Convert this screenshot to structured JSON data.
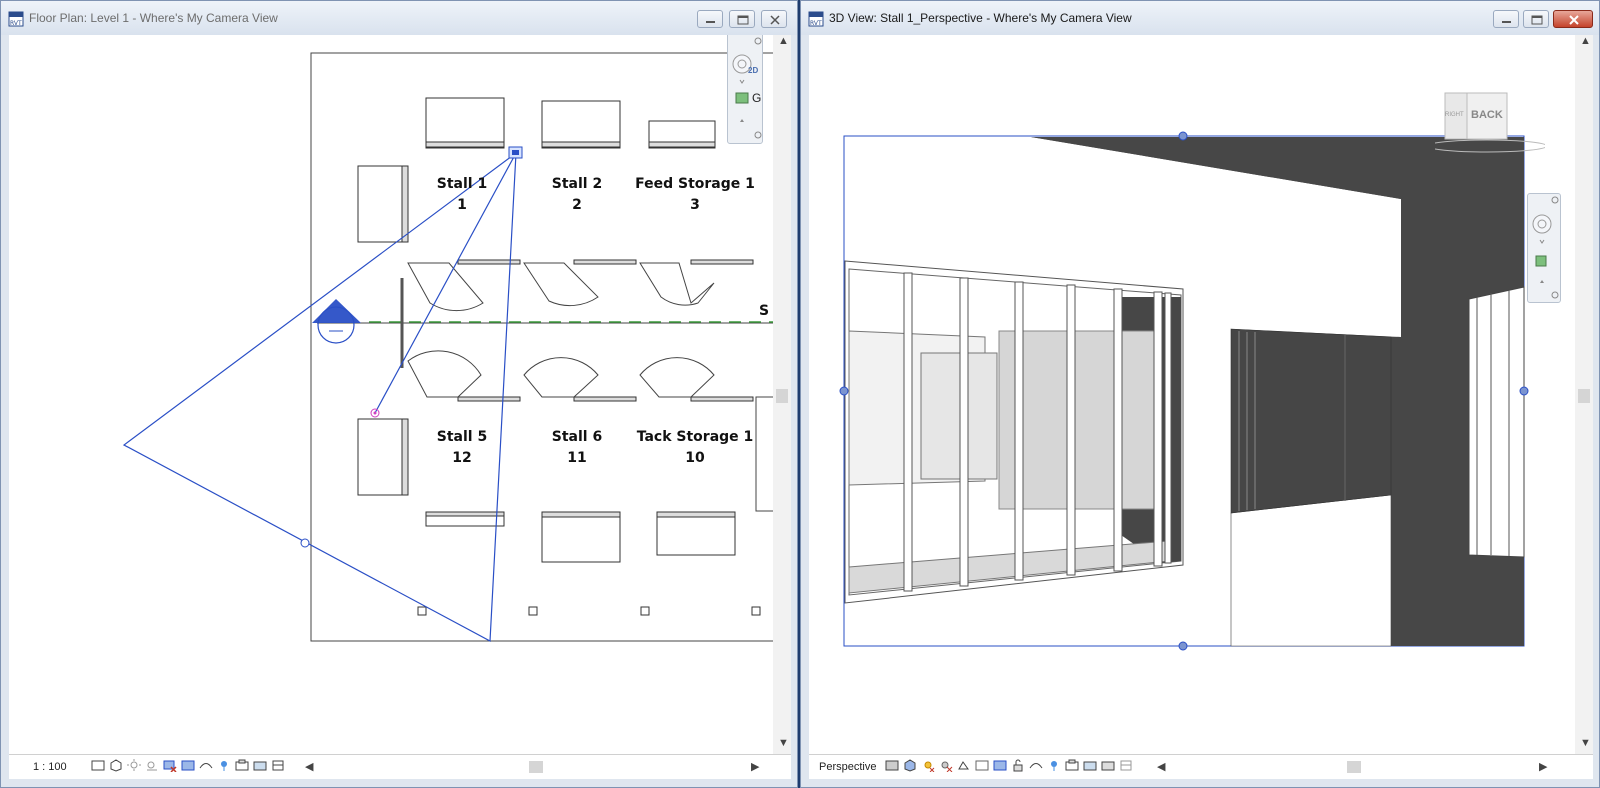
{
  "left_window": {
    "title": "Floor Plan: Level 1 - Where's My Camera View",
    "scale": "1 : 100",
    "rooms": [
      {
        "name": "Stall 1",
        "number": "1"
      },
      {
        "name": "Stall 2",
        "number": "2"
      },
      {
        "name": "Feed Storage 1",
        "number": "3"
      },
      {
        "name": "Stall 5",
        "number": "12"
      },
      {
        "name": "Stall 6",
        "number": "11"
      },
      {
        "name": "Tack Storage 1",
        "number": "10"
      }
    ],
    "partial_label": "S",
    "nav_tool_2d": "2D",
    "nav_tool_g": "G"
  },
  "right_window": {
    "title": "3D View: Stall 1_Perspective - Where's My Camera View",
    "view_mode": "Perspective",
    "viewcube": {
      "front": "BACK",
      "side": "RIGHT"
    }
  },
  "colors": {
    "selection_blue": "#2a4fc6",
    "wall_dark": "#474747",
    "title_bg": "#dfe6ef",
    "close_red": "#c4432b"
  }
}
